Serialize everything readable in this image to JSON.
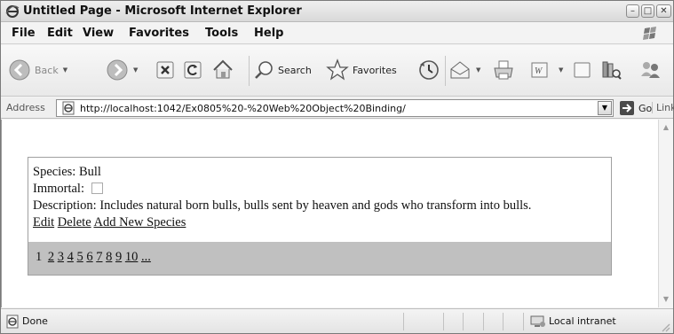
{
  "window": {
    "title": "Untitled Page - Microsoft Internet Explorer",
    "buttons": [
      "minimize",
      "maximize",
      "close"
    ]
  },
  "menu": {
    "items": [
      "File",
      "Edit",
      "View",
      "Favorites",
      "Tools",
      "Help"
    ]
  },
  "toolbar": {
    "back_label": "Back",
    "search_label": "Search",
    "favorites_label": "Favorites"
  },
  "address": {
    "label": "Address",
    "url": "http://localhost:1042/Ex0805%20-%20Web%20Object%20Binding/",
    "go_label": "Go",
    "links_label": "Links"
  },
  "record": {
    "species_label": "Species:",
    "species_value": "Bull",
    "immortal_label": "Immortal:",
    "immortal_checked": false,
    "description_label": "Description:",
    "description_value": "Includes natural born bulls, bulls sent by heaven and gods who transform into bulls.",
    "actions": {
      "edit": "Edit",
      "delete": "Delete",
      "add_new": "Add New Species"
    }
  },
  "pager": {
    "current": "1",
    "pages": [
      "2",
      "3",
      "4",
      "5",
      "6",
      "7",
      "8",
      "9",
      "10",
      "..."
    ]
  },
  "status": {
    "text": "Done",
    "zone": "Local intranet"
  },
  "colors": {
    "pager_background": "#c0c0c0",
    "window_chrome": "#f3f3f3"
  }
}
